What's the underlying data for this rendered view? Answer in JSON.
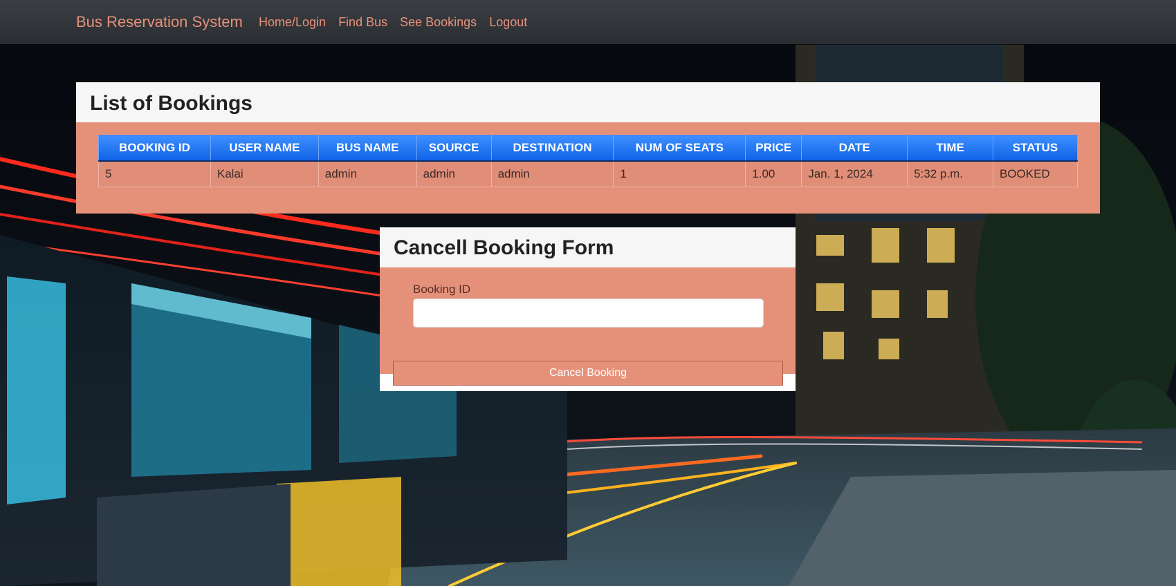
{
  "navbar": {
    "brand": "Bus Reservation System",
    "links": [
      "Home/Login",
      "Find Bus",
      "See Bookings",
      "Logout"
    ]
  },
  "bookings": {
    "title": "List of Bookings",
    "columns": [
      "BOOKING ID",
      "USER NAME",
      "BUS NAME",
      "SOURCE",
      "DESTINATION",
      "NUM OF SEATS",
      "PRICE",
      "DATE",
      "TIME",
      "STATUS"
    ],
    "rows": [
      [
        "5",
        "Kalai",
        "admin",
        "admin",
        "admin",
        "1",
        "1.00",
        "Jan. 1, 2024",
        "5:32 p.m.",
        "BOOKED"
      ]
    ]
  },
  "cancel_form": {
    "title": "Cancell Booking Form",
    "field_label": "Booking ID",
    "field_value": "",
    "button_label": "Cancel Booking"
  },
  "colors": {
    "accent": "#e5917a",
    "navbar": "#343a40",
    "table_header": "#1a6ef5"
  }
}
